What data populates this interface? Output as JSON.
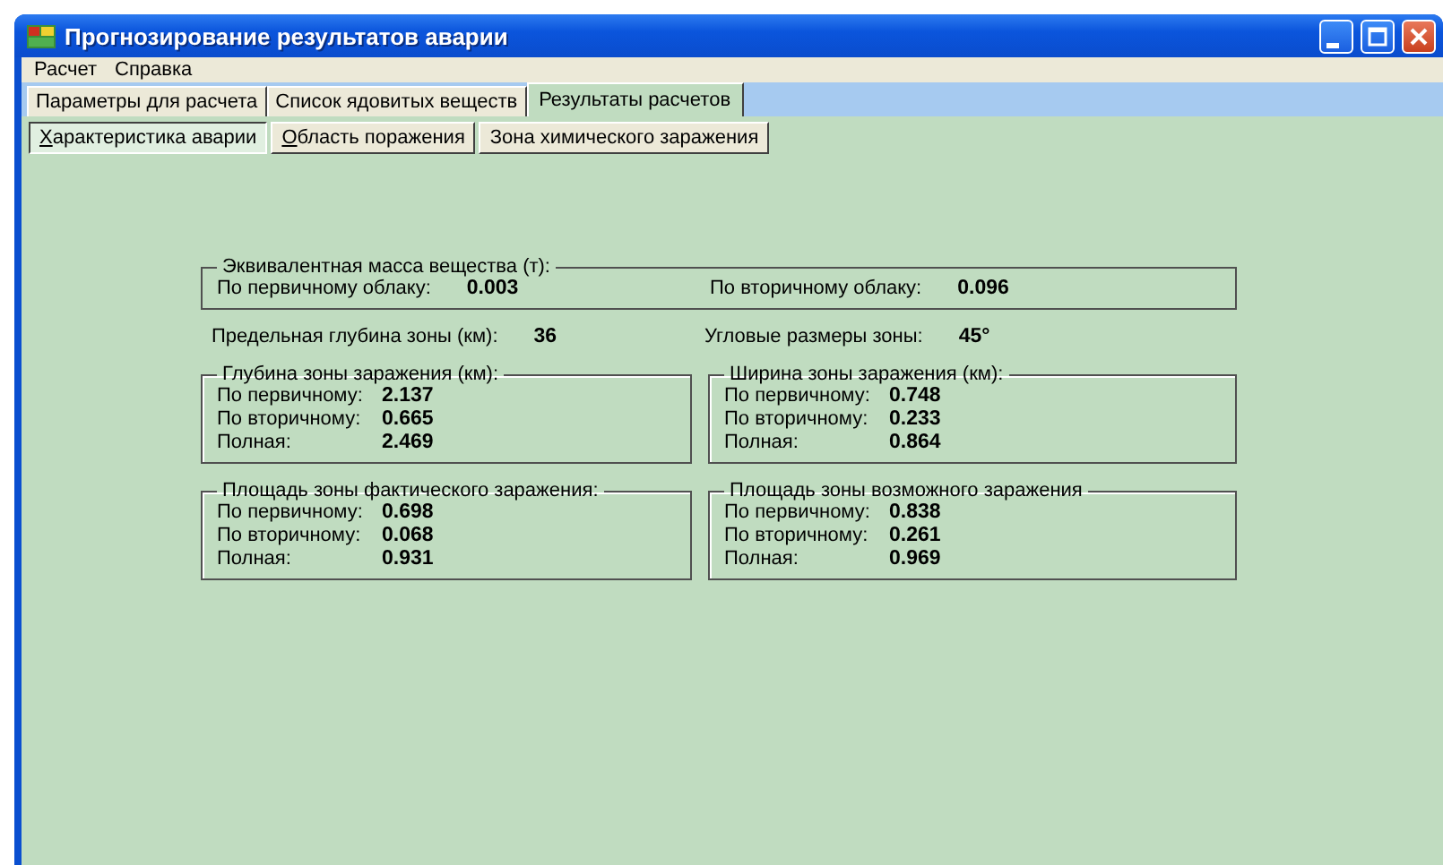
{
  "window": {
    "title": "Прогнозирование результатов аварии"
  },
  "menu": [
    {
      "label": "Расчет"
    },
    {
      "label": "Справка"
    }
  ],
  "tabs": [
    {
      "label": "Параметры для расчета",
      "selected": false
    },
    {
      "label": "Список ядовитых веществ",
      "selected": false
    },
    {
      "label": "Результаты расчетов",
      "selected": true
    }
  ],
  "subtabs": [
    {
      "label": "Характеристика аварии",
      "selected": true,
      "underline_first": true
    },
    {
      "label": "Область поражения",
      "selected": false,
      "underline_first": true
    },
    {
      "label": "Зона химического заражения",
      "selected": false,
      "underline_first": false
    }
  ],
  "equivalent_mass": {
    "title": "Эквивалентная масса вещества (т):",
    "items": [
      {
        "label": "По первичному облаку:",
        "value": "0.003"
      },
      {
        "label": "По вторичному облаку:",
        "value": "0.096"
      }
    ]
  },
  "zone_info": [
    {
      "label": "Предельная глубина зоны (км):",
      "value": "36"
    },
    {
      "label": "Угловые размеры зоны:",
      "value": "45°"
    }
  ],
  "groups": [
    {
      "title": "Глубина зоны заражения (км):",
      "rows": [
        {
          "label": "По первичному:",
          "value": "2.137"
        },
        {
          "label": "По вторичному:",
          "value": "0.665"
        },
        {
          "label": "Полная:",
          "value": "2.469"
        }
      ]
    },
    {
      "title": "Ширина зоны заражения (км):",
      "rows": [
        {
          "label": "По первичному:",
          "value": "0.748"
        },
        {
          "label": "По вторичному:",
          "value": "0.233"
        },
        {
          "label": "Полная:",
          "value": "0.864"
        }
      ]
    },
    {
      "title": "Площадь зоны фактического заражения:",
      "rows": [
        {
          "label": "По первичному:",
          "value": "0.698"
        },
        {
          "label": "По вторичному:",
          "value": "0.068"
        },
        {
          "label": "Полная:",
          "value": "0.931"
        }
      ]
    },
    {
      "title": "Площадь зоны возможного заражения",
      "rows": [
        {
          "label": "По первичному:",
          "value": "0.838"
        },
        {
          "label": "По вторичному:",
          "value": "0.261"
        },
        {
          "label": "Полная:",
          "value": "0.969"
        }
      ]
    }
  ]
}
